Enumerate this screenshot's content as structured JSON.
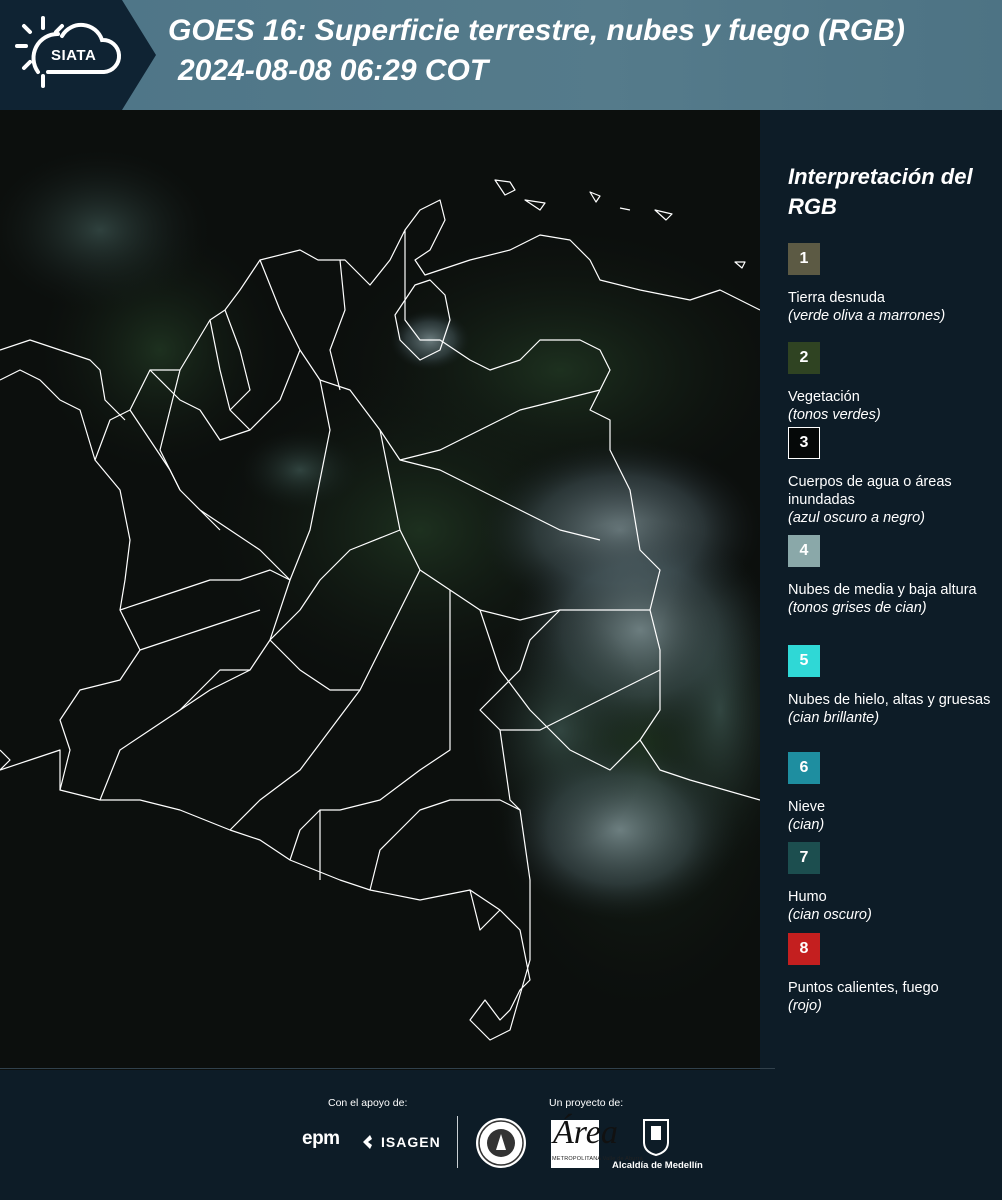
{
  "header": {
    "logo_text": "SIATA",
    "title_line1": "GOES 16: Superficie terrestre, nubes y fuego (RGB)",
    "title_line2": "2024-08-08 06:29 COT"
  },
  "legend": {
    "title": "Interpretación del RGB",
    "items": [
      {
        "number": "1",
        "label": "Tierra desnuda",
        "sublabel": "(verde oliva a marrones)",
        "color": "#5c5a44"
      },
      {
        "number": "2",
        "label": "Vegetación",
        "sublabel": "(tonos verdes)",
        "color": "#2f4322"
      },
      {
        "number": "3",
        "label": "Cuerpos de agua o áreas inundadas",
        "sublabel": "(azul oscuro a negro)",
        "color": "#050808"
      },
      {
        "number": "4",
        "label": "Nubes de media y baja altura",
        "sublabel": "(tonos grises de cian)",
        "color": "#8aa8a9"
      },
      {
        "number": "5",
        "label": "Nubes de hielo, altas y gruesas",
        "sublabel": "(cian brillante)",
        "color": "#2fd8d6"
      },
      {
        "number": "6",
        "label": "Nieve",
        "sublabel": "(cian)",
        "color": "#1e8ea0"
      },
      {
        "number": "7",
        "label": "Humo",
        "sublabel": "(cian oscuro)",
        "color": "#1c4e4f"
      },
      {
        "number": "8",
        "label": "Puntos calientes, fuego",
        "sublabel": "(rojo)",
        "color": "#c41f1f"
      }
    ]
  },
  "footer": {
    "support_caption": "Con el apoyo de:",
    "project_caption": "Un proyecto de:",
    "sponsor1": "epm",
    "sponsor2": "ISAGEN",
    "partner1": "Área",
    "partner1_small": "METROPOLITANA Valle de Aburrá",
    "partner2": "Alcaldía de Medellín"
  },
  "colors": {
    "header_band": "#557b8b",
    "header_dark": "#0f2333",
    "background": "#0d1c27",
    "map_border_lines": "#ffffff"
  }
}
